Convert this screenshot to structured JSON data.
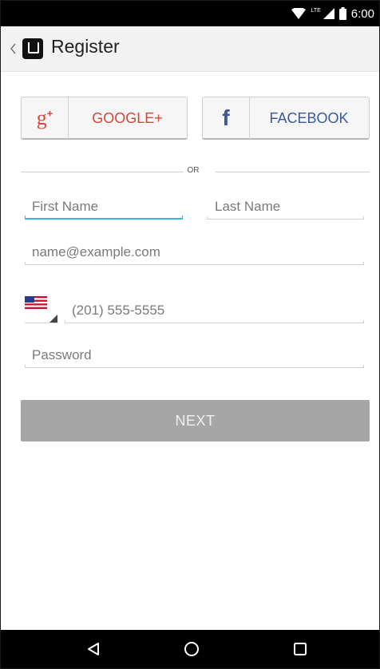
{
  "status_bar": {
    "network": "LTE",
    "time": "6:00",
    "icons": [
      "wifi-icon",
      "signal-icon",
      "battery-icon"
    ]
  },
  "app_bar": {
    "title": "Register",
    "logo": "uber-logo",
    "back_icon": "chevron-left-icon"
  },
  "social": {
    "google": {
      "icon": "google-plus-icon",
      "icon_text": "g",
      "icon_sup": "+",
      "label": "GOOGLE+"
    },
    "facebook": {
      "icon": "facebook-icon",
      "icon_text": "f",
      "label": "FACEBOOK"
    }
  },
  "divider": {
    "label": "OR"
  },
  "form": {
    "first_name": {
      "placeholder": "First Name",
      "value": ""
    },
    "last_name": {
      "placeholder": "Last Name",
      "value": ""
    },
    "email": {
      "placeholder": "name@example.com",
      "value": ""
    },
    "country": {
      "flag": "us-flag-icon"
    },
    "phone": {
      "placeholder": "(201) 555-5555",
      "value": ""
    },
    "password": {
      "placeholder": "Password",
      "value": ""
    }
  },
  "next_button": {
    "label": "NEXT"
  },
  "nav_bar": {
    "icons": [
      "back-triangle-icon",
      "home-circle-icon",
      "recents-square-icon"
    ]
  },
  "colors": {
    "accent": "#3cb7d6",
    "google": "#d34836",
    "facebook": "#3b5998",
    "next_disabled": "#a6a6a6"
  }
}
